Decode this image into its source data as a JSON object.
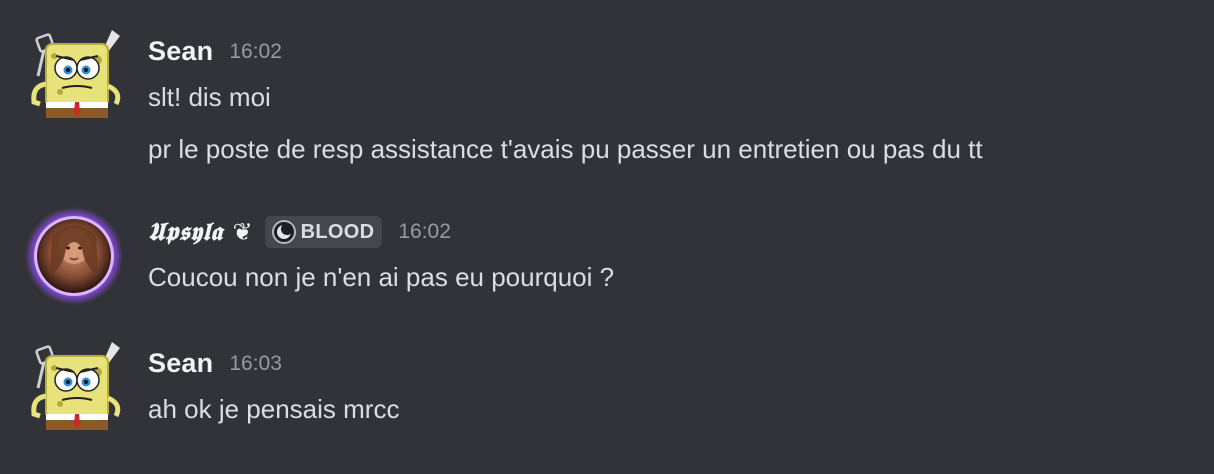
{
  "messages": [
    {
      "author": "Sean",
      "time": "16:02",
      "avatar_icon": "spongebob-avatar",
      "lines": [
        "slt! dis moi",
        "pr le poste de resp assistance t'avais pu passer un entretien ou pas du tt"
      ]
    },
    {
      "author": "𝖀𝖕𝖘𝖞𝖑𝖆",
      "decoration": "❦",
      "tag": {
        "icon": "moon-badge-icon",
        "label": "BLOOD"
      },
      "time": "16:02",
      "avatar_icon": "portrait-avatar",
      "lines": [
        "Coucou non je n'en ai pas eu pourquoi ?"
      ]
    },
    {
      "author": "Sean",
      "time": "16:03",
      "avatar_icon": "spongebob-avatar",
      "lines": [
        "ah ok je pensais mrcc"
      ]
    }
  ],
  "colors": {
    "background": "#313338",
    "author": "#f2f3f5",
    "timestamp": "#949ba4",
    "text": "#dbdee1",
    "avatar_ring": "#a855f7"
  }
}
